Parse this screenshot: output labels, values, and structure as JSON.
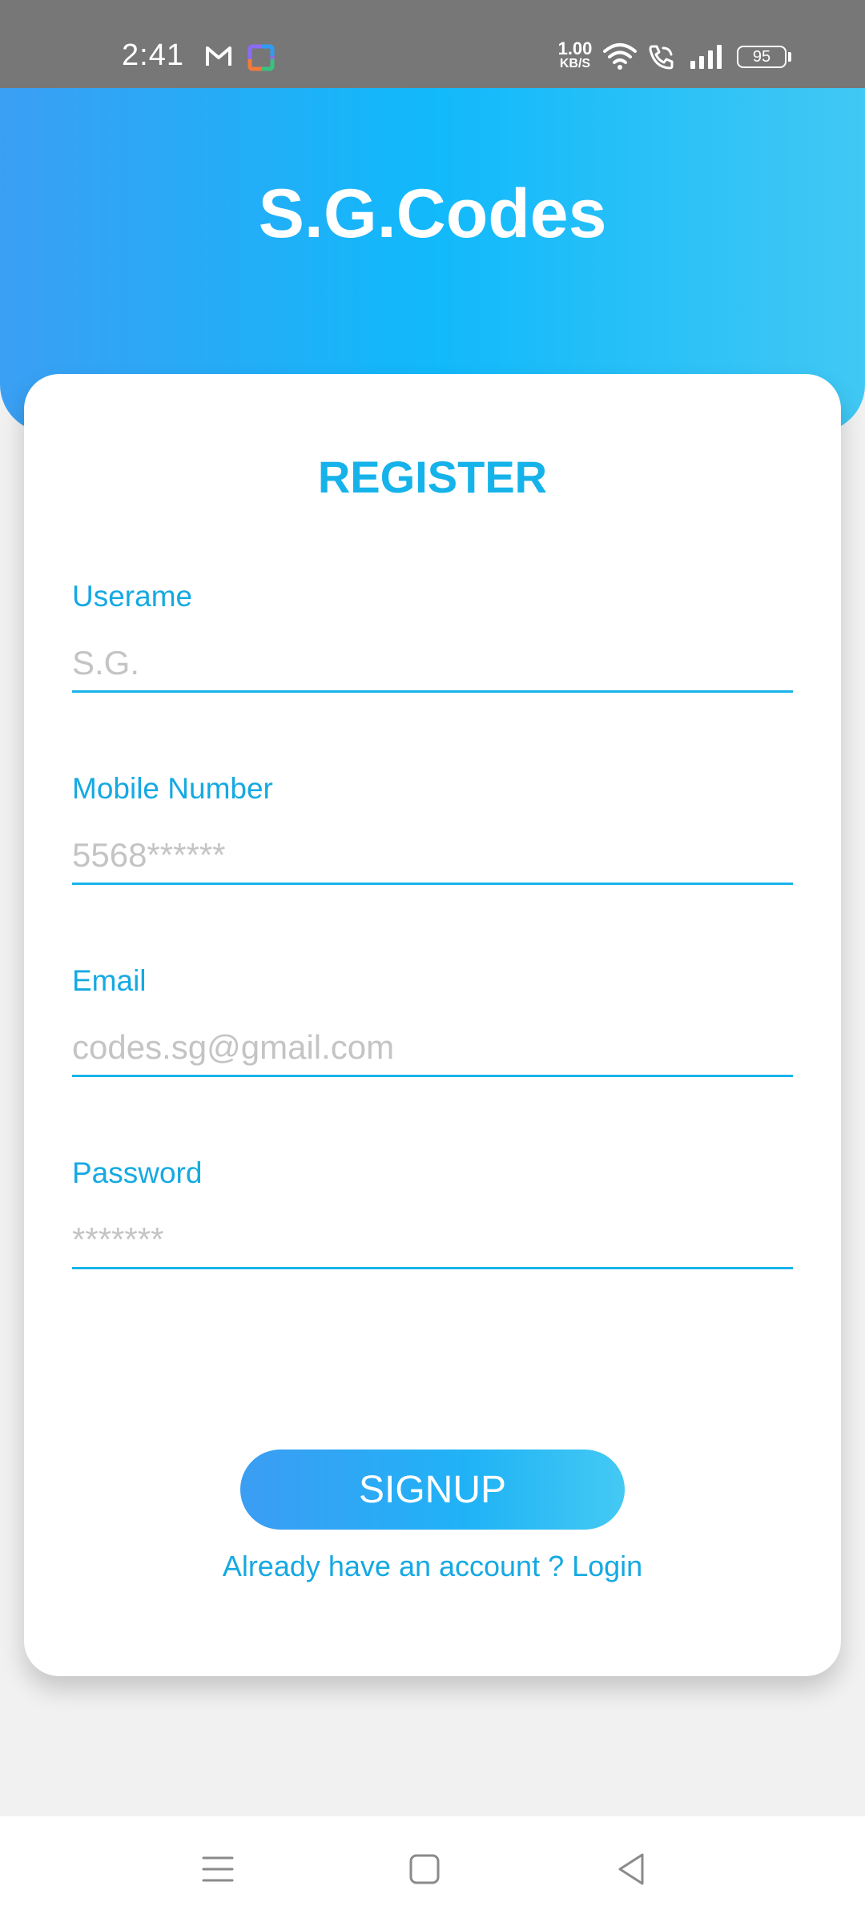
{
  "status_bar": {
    "time": "2:41",
    "network_speed": "1.00",
    "network_unit": "KB/S",
    "battery": "95",
    "icons": [
      "gmail-icon",
      "app-icon",
      "wifi-icon",
      "wifi-call-icon",
      "signal-icon",
      "battery-icon"
    ]
  },
  "header": {
    "title": "S.G.Codes"
  },
  "form": {
    "title": "REGISTER",
    "fields": [
      {
        "label": "Userame",
        "placeholder": "S.G."
      },
      {
        "label": "Mobile Number",
        "placeholder": "5568******"
      },
      {
        "label": "Email",
        "placeholder": "codes.sg@gmail.com"
      },
      {
        "label": "Password",
        "placeholder": "*******"
      }
    ],
    "signup_label": "SIGNUP",
    "login_link": "Already have an account ? Login"
  },
  "nav": {
    "icons": [
      "menu-icon",
      "home-icon",
      "back-icon"
    ]
  },
  "colors": {
    "accent": "#16b3ea",
    "header_gradient_start": "#3b9ff3",
    "header_gradient_mid": "#11b9fb",
    "header_gradient_end": "#41c8f4",
    "status_bar": "#777777",
    "background": "#f1f1f1"
  }
}
